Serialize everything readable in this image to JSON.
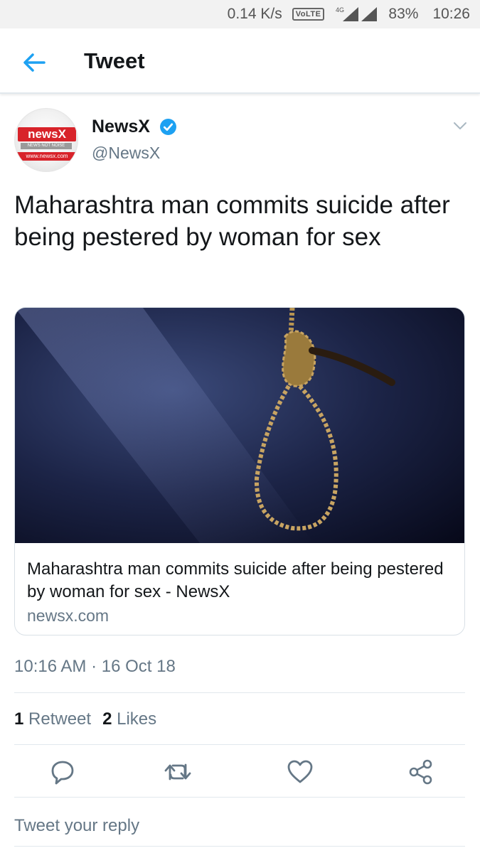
{
  "status_bar": {
    "speed": "0.14 K/s",
    "volte": "VoLTE",
    "network": "4G",
    "battery": "83%",
    "time": "10:26"
  },
  "header": {
    "title": "Tweet",
    "back_icon": "arrow-left-icon"
  },
  "tweet": {
    "avatar_logo": "newsX",
    "avatar_tagline": "NEWS NOT NOISE",
    "avatar_url": "www.newsx.com",
    "name": "NewsX",
    "handle": "@NewsX",
    "text": "Maharashtra man commits suicide after being pestered by woman for sex",
    "card": {
      "title": "Maharashtra man commits suicide after being pestered by woman for sex - NewsX",
      "domain": "newsx.com"
    },
    "timestamp": "10:16 AM · 16 Oct 18",
    "retweet_count": "1",
    "retweet_label": "Retweet",
    "like_count": "2",
    "like_label": "Likes"
  },
  "reply": {
    "placeholder": "Tweet your reply"
  },
  "colors": {
    "accent": "#1da1f2",
    "secondary_text": "#657786",
    "divider": "#e1e8ed"
  }
}
